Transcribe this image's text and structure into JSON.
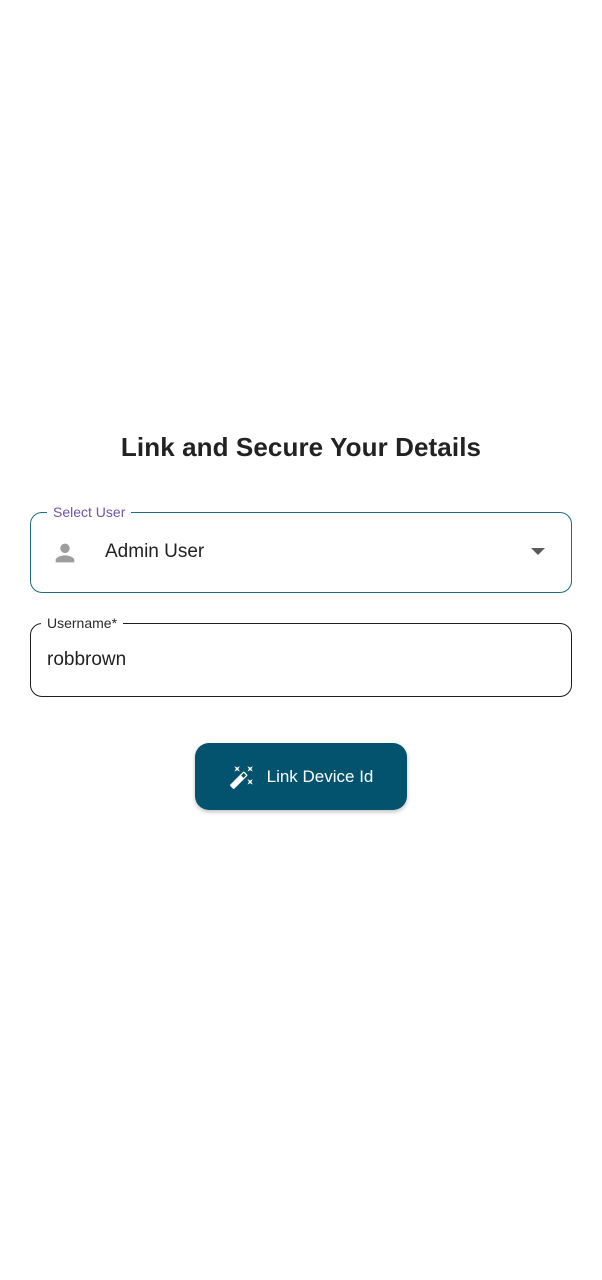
{
  "page": {
    "title": "Link and Secure Your Details"
  },
  "select_user": {
    "label": "Select User",
    "value": "Admin User",
    "leading_icon": "person-icon",
    "trailing_icon": "dropdown-arrow-icon"
  },
  "username": {
    "label": "Username*",
    "value": "robbrown"
  },
  "link_button": {
    "label": "Link Device Id",
    "icon": "magic-wand-icon"
  },
  "colors": {
    "primary": "#03536f",
    "select_border": "#1f6b80",
    "select_label": "#6f55a7",
    "text": "#222222"
  }
}
